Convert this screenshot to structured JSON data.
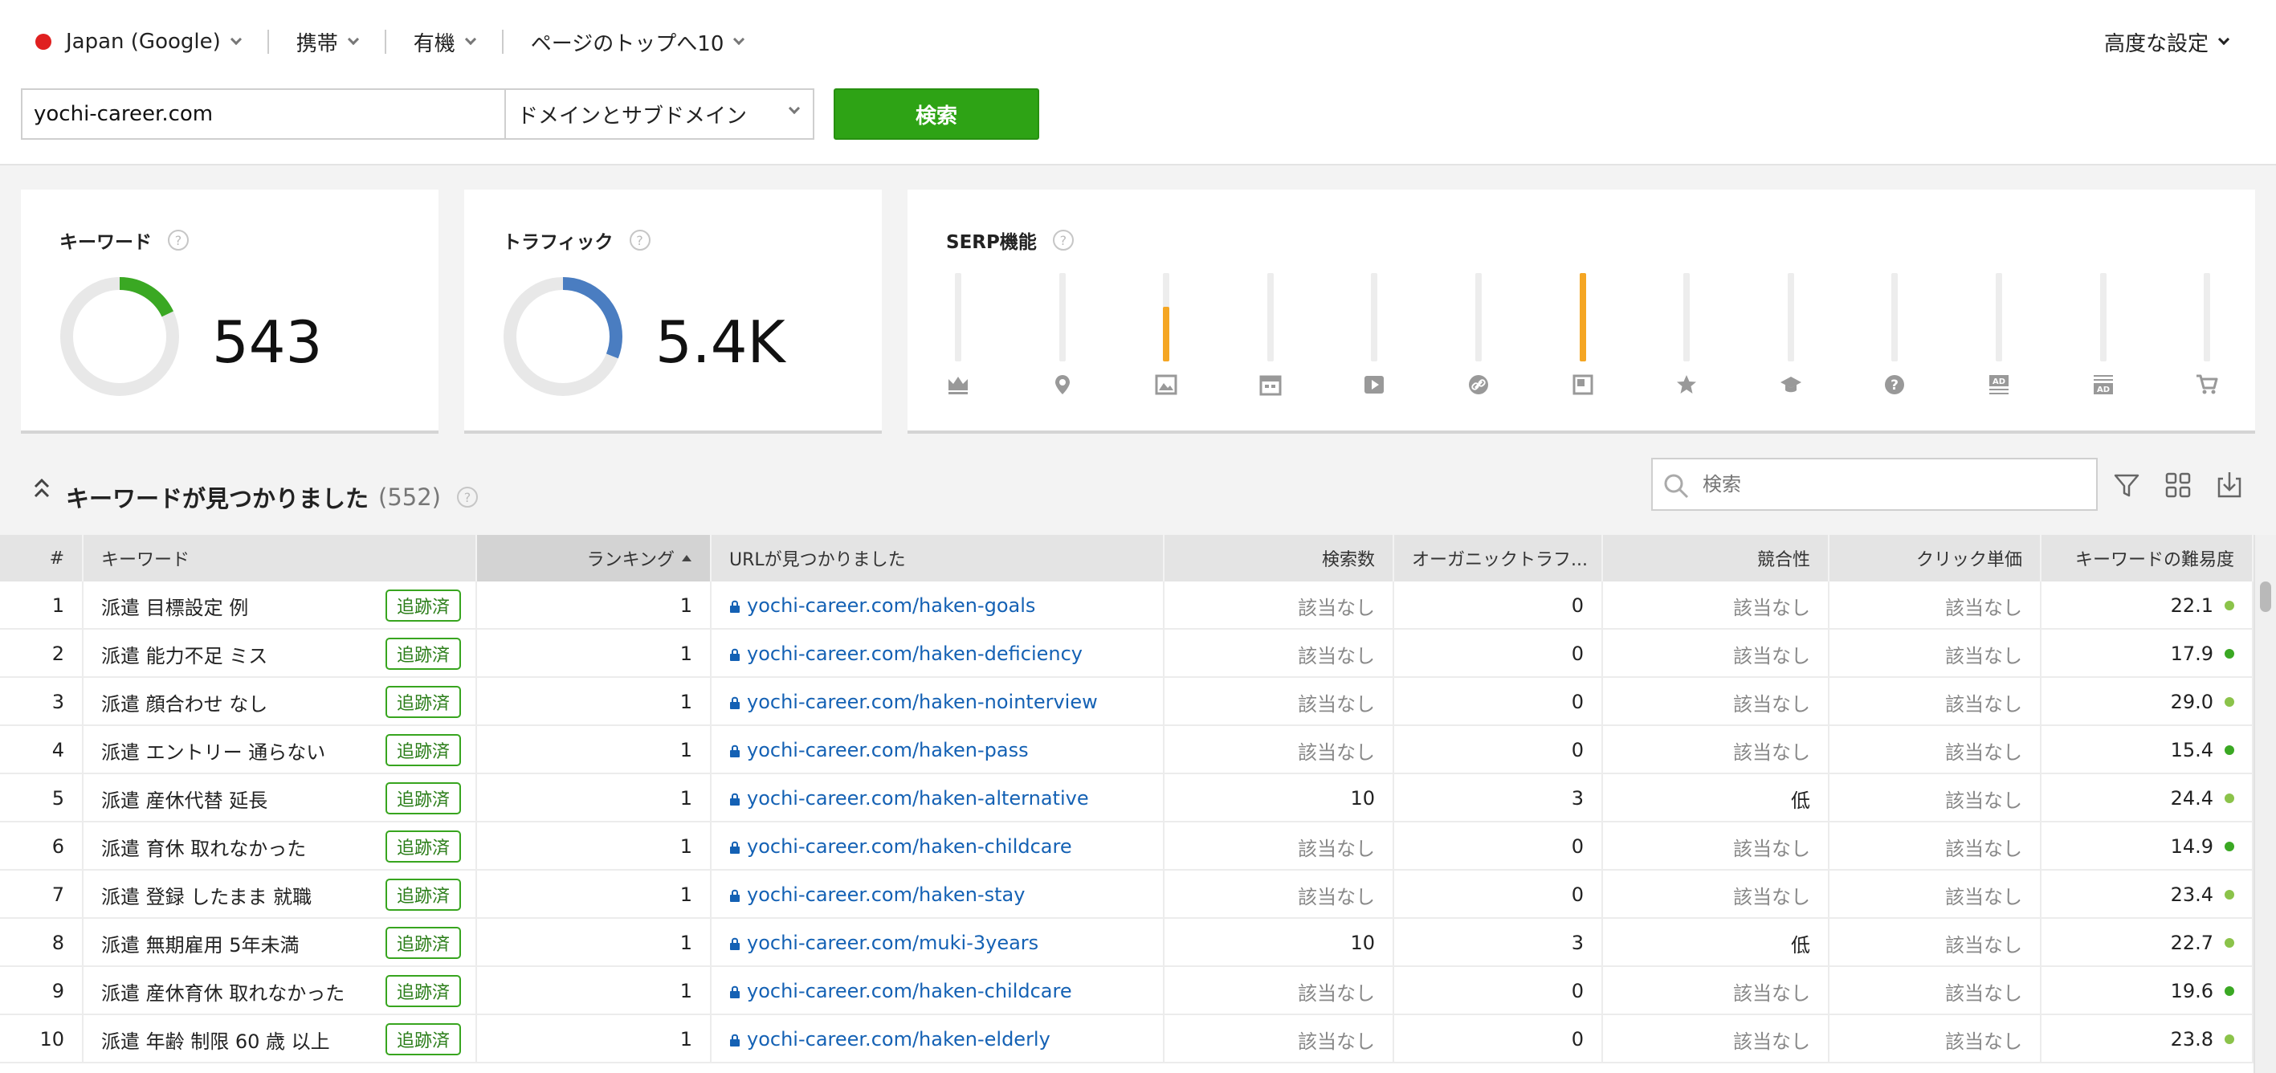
{
  "filters": {
    "country": "Japan (Google)",
    "device": "携帯",
    "search_type": "有機",
    "position": "ページのトップへ10",
    "advanced": "高度な設定"
  },
  "search": {
    "domain_value": "yochi-career.com",
    "scope": "ドメインとサブドメイン",
    "button": "検索"
  },
  "cards": {
    "keywords": {
      "title": "キーワード",
      "value": "543",
      "fraction": 0.18,
      "color": "#3aa823"
    },
    "traffic": {
      "title": "トラフィック",
      "value": "5.4K",
      "fraction": 0.31,
      "color": "#4a7dc1"
    },
    "serp": {
      "title": "SERP機能",
      "features": [
        {
          "icon": "crown-icon",
          "level": 0
        },
        {
          "icon": "map-pin-icon",
          "level": 0
        },
        {
          "icon": "image-icon",
          "level": 0.62
        },
        {
          "icon": "calendar-icon",
          "level": 0
        },
        {
          "icon": "video-icon",
          "level": 0
        },
        {
          "icon": "link-icon",
          "level": 0
        },
        {
          "icon": "featured-snippet-icon",
          "level": 1.0
        },
        {
          "icon": "star-icon",
          "level": 0
        },
        {
          "icon": "graduation-cap-icon",
          "level": 0
        },
        {
          "icon": "question-icon",
          "level": 0
        },
        {
          "icon": "ad-top-icon",
          "level": 0
        },
        {
          "icon": "ad-bottom-icon",
          "level": 0
        },
        {
          "icon": "shopping-cart-icon",
          "level": 0
        }
      ],
      "accent": "#f5a623"
    }
  },
  "keywords_section": {
    "title": "キーワードが見つかりました",
    "count": "(552)",
    "search_placeholder": "検索"
  },
  "table": {
    "columns": {
      "num": "#",
      "keyword": "キーワード",
      "rank": "ランキング",
      "url": "URLが見つかりました",
      "volume": "検索数",
      "traffic": "オーガニックトラフ...",
      "competition": "競合性",
      "cpc": "クリック単価",
      "kd": "キーワードの難易度"
    },
    "tracked_label": "追跡済",
    "rows": [
      {
        "n": "1",
        "kw": "派遣 目標設定 例",
        "rank": "1",
        "url": "yochi-career.com/haken-goals",
        "vol": "該当なし",
        "traffic": "0",
        "comp": "該当なし",
        "cpc": "該当なし",
        "kd": "22.1",
        "kd_color": "#8bc34a"
      },
      {
        "n": "2",
        "kw": "派遣 能力不足 ミス",
        "rank": "1",
        "url": "yochi-career.com/haken-deficiency",
        "vol": "該当なし",
        "traffic": "0",
        "comp": "該当なし",
        "cpc": "該当なし",
        "kd": "17.9",
        "kd_color": "#3aa823"
      },
      {
        "n": "3",
        "kw": "派遣 顔合わせ なし",
        "rank": "1",
        "url": "yochi-career.com/haken-nointerview",
        "vol": "該当なし",
        "traffic": "0",
        "comp": "該当なし",
        "cpc": "該当なし",
        "kd": "29.0",
        "kd_color": "#8bc34a"
      },
      {
        "n": "4",
        "kw": "派遣 エントリー 通らない",
        "rank": "1",
        "url": "yochi-career.com/haken-pass",
        "vol": "該当なし",
        "traffic": "0",
        "comp": "該当なし",
        "cpc": "該当なし",
        "kd": "15.4",
        "kd_color": "#3aa823"
      },
      {
        "n": "5",
        "kw": "派遣 産休代替 延長",
        "rank": "1",
        "url": "yochi-career.com/haken-alternative",
        "vol": "10",
        "traffic": "3",
        "comp": "低",
        "cpc": "該当なし",
        "kd": "24.4",
        "kd_color": "#8bc34a"
      },
      {
        "n": "6",
        "kw": "派遣 育休 取れなかった",
        "rank": "1",
        "url": "yochi-career.com/haken-childcare",
        "vol": "該当なし",
        "traffic": "0",
        "comp": "該当なし",
        "cpc": "該当なし",
        "kd": "14.9",
        "kd_color": "#3aa823"
      },
      {
        "n": "7",
        "kw": "派遣 登録 したまま 就職",
        "rank": "1",
        "url": "yochi-career.com/haken-stay",
        "vol": "該当なし",
        "traffic": "0",
        "comp": "該当なし",
        "cpc": "該当なし",
        "kd": "23.4",
        "kd_color": "#8bc34a"
      },
      {
        "n": "8",
        "kw": "派遣 無期雇用 5年未満",
        "rank": "1",
        "url": "yochi-career.com/muki-3years",
        "vol": "10",
        "traffic": "3",
        "comp": "低",
        "cpc": "該当なし",
        "kd": "22.7",
        "kd_color": "#8bc34a"
      },
      {
        "n": "9",
        "kw": "派遣 産休育休 取れなかった",
        "rank": "1",
        "url": "yochi-career.com/haken-childcare",
        "vol": "該当なし",
        "traffic": "0",
        "comp": "該当なし",
        "cpc": "該当なし",
        "kd": "19.6",
        "kd_color": "#3aa823"
      },
      {
        "n": "10",
        "kw": "派遣 年齢 制限 60 歳 以上",
        "rank": "1",
        "url": "yochi-career.com/haken-elderly",
        "vol": "該当なし",
        "traffic": "0",
        "comp": "該当なし",
        "cpc": "該当なし",
        "kd": "23.8",
        "kd_color": "#8bc34a"
      }
    ]
  }
}
